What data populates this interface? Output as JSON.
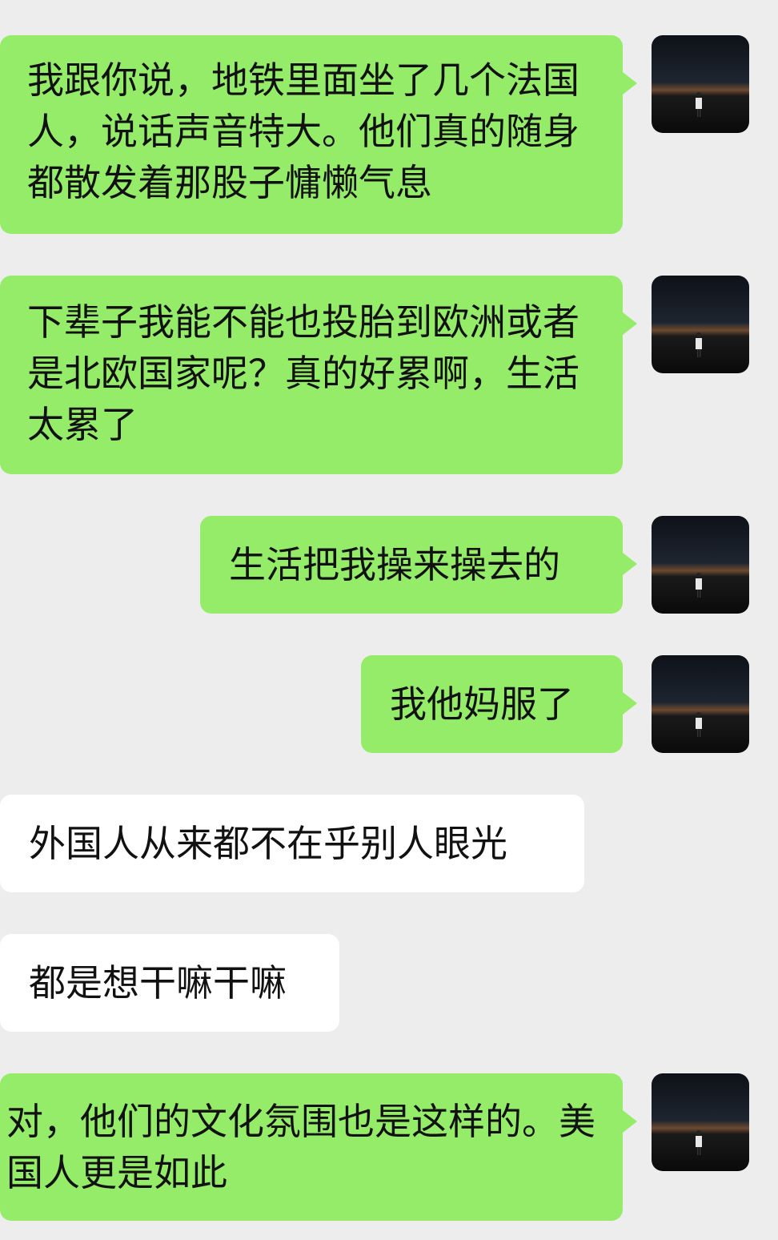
{
  "messages": [
    {
      "side": "sent",
      "text": "我跟你说，地铁里面坐了几个法国人，说话声音特大。他们真的随身都散发着那股子慵懒气息"
    },
    {
      "side": "sent",
      "text": "下辈子我能不能也投胎到欧洲或者是北欧国家呢？真的好累啊，生活太累了"
    },
    {
      "side": "sent",
      "text": "生活把我操来操去的"
    },
    {
      "side": "sent",
      "text": "我他妈服了"
    },
    {
      "side": "received",
      "text": "外国人从来都不在乎别人眼光"
    },
    {
      "side": "received",
      "text": "都是想干嘛干嘛"
    },
    {
      "side": "sent",
      "text": "对，他们的文化氛围也是这样的。美国人更是如此"
    }
  ],
  "avatar_icon": "night-sky-figure-avatar",
  "colors": {
    "background": "#ededed",
    "sent_bubble": "#95ec69",
    "received_bubble": "#ffffff",
    "text": "#111111"
  }
}
